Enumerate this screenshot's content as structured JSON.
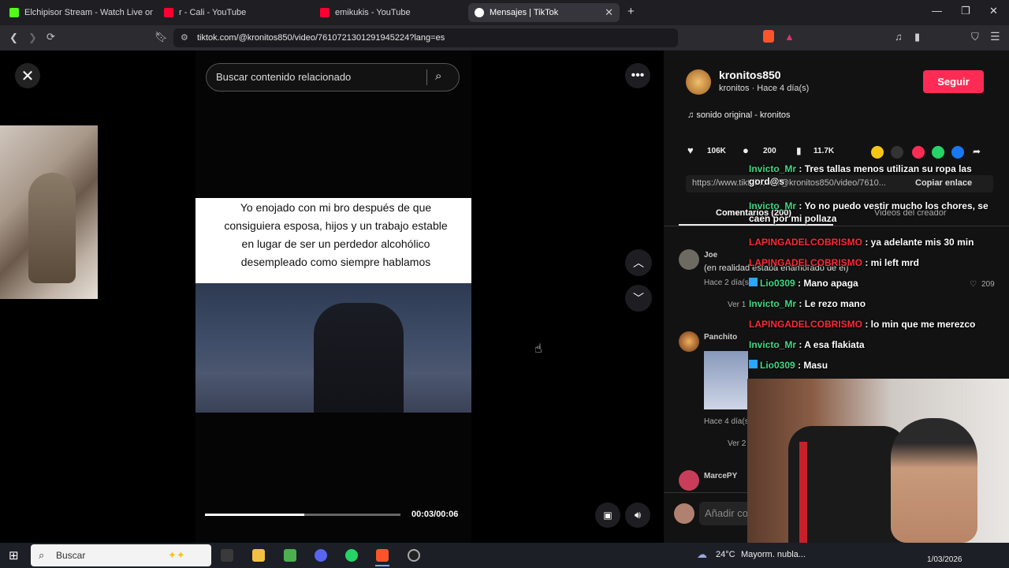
{
  "browser": {
    "tabs": [
      {
        "label": "Elchipisor Stream - Watch Live on",
        "color": "#53fc18"
      },
      {
        "label": "r - Cali - YouTube",
        "color": "#ff0033"
      },
      {
        "label": "emikukis - YouTube",
        "color": "#ff0033"
      },
      {
        "label": "Mensajes | TikTok",
        "color": "#ffffff"
      }
    ],
    "new_tab": "+",
    "url": "tiktok.com/@kronitos850/video/7610721301291945224?lang=es",
    "window_controls": [
      "—",
      "❐",
      "✕"
    ]
  },
  "video": {
    "search_placeholder": "Buscar contenido relacionado",
    "caption": "Yo enojado con mi bro después de que consiguiera esposa, hijos y un trabajo estable en lugar de ser un perdedor alcohólico desempleado como siempre hablamos",
    "progress": 0.51,
    "time": "00:03/00:06"
  },
  "profile": {
    "username": "kronitos850",
    "meta": "kronitos · Hace 4 día(s)",
    "follow_label": "Seguir",
    "music": "sonido original - kronitos",
    "likes": "106K",
    "comments": "200",
    "saves": "11.7K",
    "link": "https://www.tiktok.com/@kronitos850/video/7610...",
    "copy_link": "Copiar enlace",
    "tab_comments": "Comentarios (200)",
    "tab_creator": "Videos del creador"
  },
  "comments": [
    {
      "name": "Joe",
      "text": "(en realidad estaba enamorado de el)",
      "time": "Hace 2 día(s)",
      "replies": "Ver 1",
      "likes": "209"
    },
    {
      "name": "Panchito",
      "time": "Hace 4 día(s)",
      "replies": "Ver 2"
    },
    {
      "name": "MarcePY"
    }
  ],
  "add_comment": "Añadir co",
  "chat": [
    {
      "user": "Invicto_Mr",
      "color": "green",
      "msg": "Tres tallas menos utilizan su ropa las gord@s"
    },
    {
      "user": "Invicto_Mr",
      "color": "green",
      "msg": "Yo no puedo vestir mucho los chores, se caen por mi pollaza"
    },
    {
      "user": "LAPINGADELCOBRISMO",
      "color": "red",
      "msg": "ya adelante mis 30 min"
    },
    {
      "user": "LAPINGADELCOBRISMO",
      "color": "red",
      "msg": "mi left mrd"
    },
    {
      "user": "Lio0309",
      "color": "blue",
      "msg": "Mano apaga"
    },
    {
      "user": "Invicto_Mr",
      "color": "green",
      "msg": "Le rezo mano"
    },
    {
      "user": "LAPINGADELCOBRISMO",
      "color": "red",
      "msg": "lo min que me merezco"
    },
    {
      "user": "Invicto_Mr",
      "color": "green",
      "msg": "A esa flakiata"
    },
    {
      "user": "Lio0309",
      "color": "blue",
      "msg": "Masu"
    }
  ],
  "taskbar": {
    "search": "Buscar",
    "weather": "24°C",
    "weather_text": "Mayorm. nubla...",
    "date": "1/03/2026"
  }
}
